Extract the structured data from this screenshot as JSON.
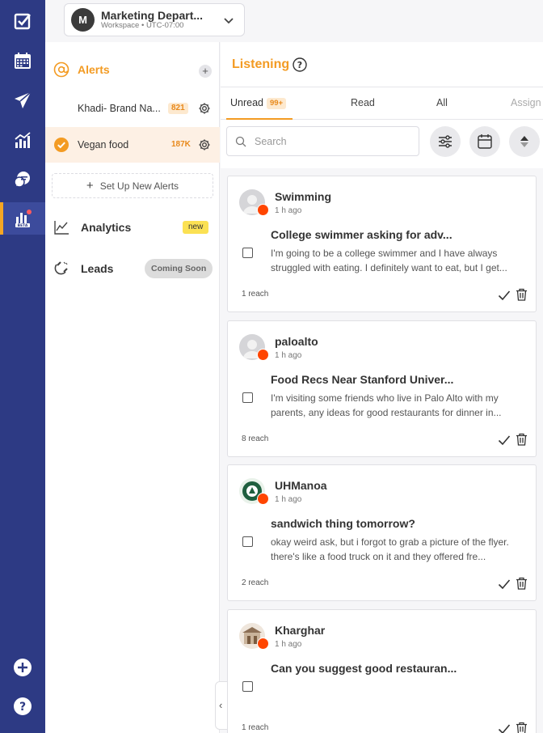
{
  "workspace": {
    "avatar_letter": "M",
    "name": "Marketing Depart...",
    "sub": "Workspace • UTC-07:00"
  },
  "sidebar": {
    "title": "Alerts",
    "alerts": [
      {
        "name": "Khadi- Brand Na...",
        "count": "821"
      },
      {
        "name": "Vegan food",
        "count": "187K"
      }
    ],
    "setup_label": "Set Up New Alerts",
    "nav": [
      {
        "label": "Analytics",
        "badge": "new"
      },
      {
        "label": "Leads",
        "badge": "Coming Soon"
      }
    ]
  },
  "main": {
    "title": "Listening",
    "tabs": [
      {
        "label": "Unread",
        "badge": "99+"
      },
      {
        "label": "Read"
      },
      {
        "label": "All"
      },
      {
        "label": "Assign"
      }
    ],
    "search_placeholder": "Search"
  },
  "posts": [
    {
      "author": "Swimming",
      "time": "1 h ago",
      "title": "College swimmer asking for adv...",
      "body": "I'm going to be a college swimmer and I have always struggled with eating. I definitely want to eat, but I get...",
      "reach": "1 reach"
    },
    {
      "author": "paloalto",
      "time": "1 h ago",
      "title": "Food Recs Near Stanford Univer...",
      "body": "I'm visiting some friends who live in Palo Alto with my parents, any ideas for good restaurants for dinner in...",
      "reach": "8 reach"
    },
    {
      "author": "UHManoa",
      "time": "1 h ago",
      "title": "sandwich thing tomorrow?",
      "body": "okay weird ask, but i forgot to grab a picture of the flyer. there's like a food truck on it and they offered fre...",
      "reach": "2 reach"
    },
    {
      "author": "Kharghar",
      "time": "1 h ago",
      "title": "Can you suggest good restauran...",
      "body": "",
      "reach": "1 reach"
    }
  ],
  "colors": {
    "accent": "#f39b23",
    "rail": "#2d3a84",
    "reddit": "#ff4500"
  }
}
